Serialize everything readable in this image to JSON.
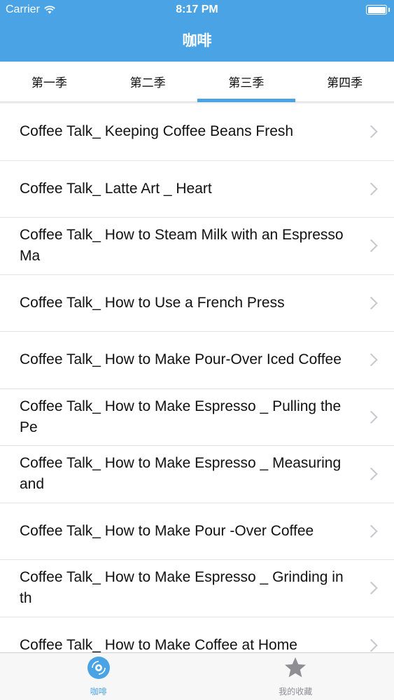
{
  "status_bar": {
    "carrier": "Carrier",
    "time": "8:17 PM",
    "battery_level": 1.0,
    "wifi_icon": "wifi-icon",
    "battery_icon": "battery-icon"
  },
  "nav": {
    "title": "咖啡"
  },
  "tabs": [
    {
      "label": "第一季",
      "active": false
    },
    {
      "label": "第二季",
      "active": false
    },
    {
      "label": "第三季",
      "active": true
    },
    {
      "label": "第四季",
      "active": false
    }
  ],
  "items": [
    {
      "title": "Coffee Talk_ Keeping Coffee Beans Fresh"
    },
    {
      "title": "Coffee Talk_ Latte Art _ Heart"
    },
    {
      "title": "Coffee Talk_ How to Steam Milk with an Espresso Ma"
    },
    {
      "title": "Coffee Talk_ How to Use a French Press"
    },
    {
      "title": "Coffee Talk_ How to Make Pour-Over Iced Coffee"
    },
    {
      "title": "Coffee Talk_ How to Make Espresso _ Pulling the Pe"
    },
    {
      "title": "Coffee Talk_ How to Make Espresso _ Measuring and"
    },
    {
      "title": "Coffee Talk_ How to Make Pour -Over Coffee"
    },
    {
      "title": "Coffee Talk_ How to Make Espresso _ Grinding in th"
    },
    {
      "title": "Coffee Talk_ How to Make Coffee at Home"
    }
  ],
  "tabbar": [
    {
      "label": "咖啡",
      "icon": "coffee-disc-icon",
      "active": true
    },
    {
      "label": "我的收藏",
      "icon": "star-icon",
      "active": false
    }
  ],
  "colors": {
    "accent": "#4aa3e5",
    "inactive": "#8e8e93"
  }
}
